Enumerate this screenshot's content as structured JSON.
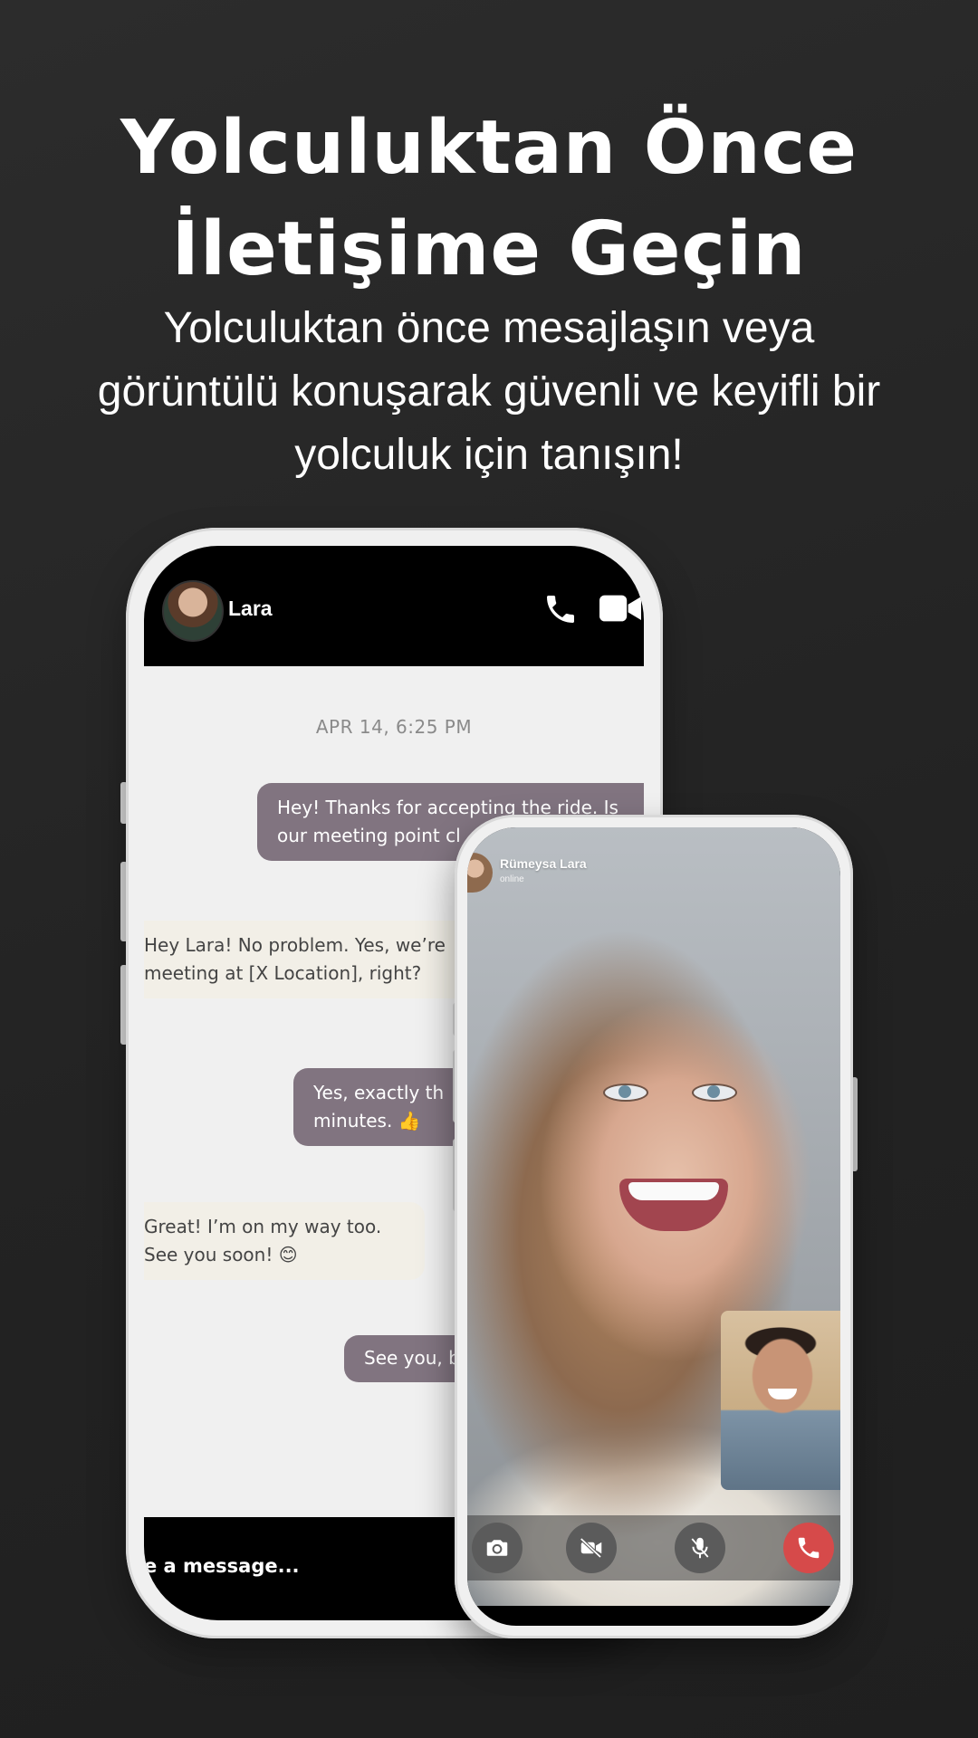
{
  "hero": {
    "title_line1": "Yolculuktan Önce",
    "title_line2": "İletişime Geçin",
    "subtitle_line1": "Yolculuktan önce mesajlaşın veya",
    "subtitle_line2": "görüntülü konuşarak güvenli ve keyifli bir",
    "subtitle_line3": "yolculuk için tanışın!"
  },
  "chat": {
    "contact_name": "Lara",
    "header_icons": [
      "phone-icon",
      "video-camera-icon"
    ],
    "timestamp": "APR 14, 6:25 PM",
    "messages": [
      {
        "direction": "out",
        "lines": [
          "Hey! Thanks for accepting the ride. Is",
          "our meeting point cl"
        ]
      },
      {
        "direction": "in",
        "lines": [
          "Hey Lara! No problem. Yes, we’re",
          "meeting at [X Location], right?"
        ]
      },
      {
        "direction": "out",
        "lines": [
          "Yes, exactly th",
          "minutes. 👍"
        ]
      },
      {
        "direction": "in",
        "lines": [
          "Great! I’m on my way too.",
          "See you soon! 😊"
        ]
      },
      {
        "direction": "out",
        "lines": [
          "See you, b"
        ]
      }
    ],
    "composer_placeholder": "e a message..."
  },
  "video_call": {
    "caller_name": "Rümeysa Lara",
    "caller_status": "online",
    "controls": [
      "flip-camera-icon",
      "camera-off-icon",
      "mic-off-icon",
      "end-call-icon"
    ],
    "end_call_color": "#d64a4a"
  }
}
